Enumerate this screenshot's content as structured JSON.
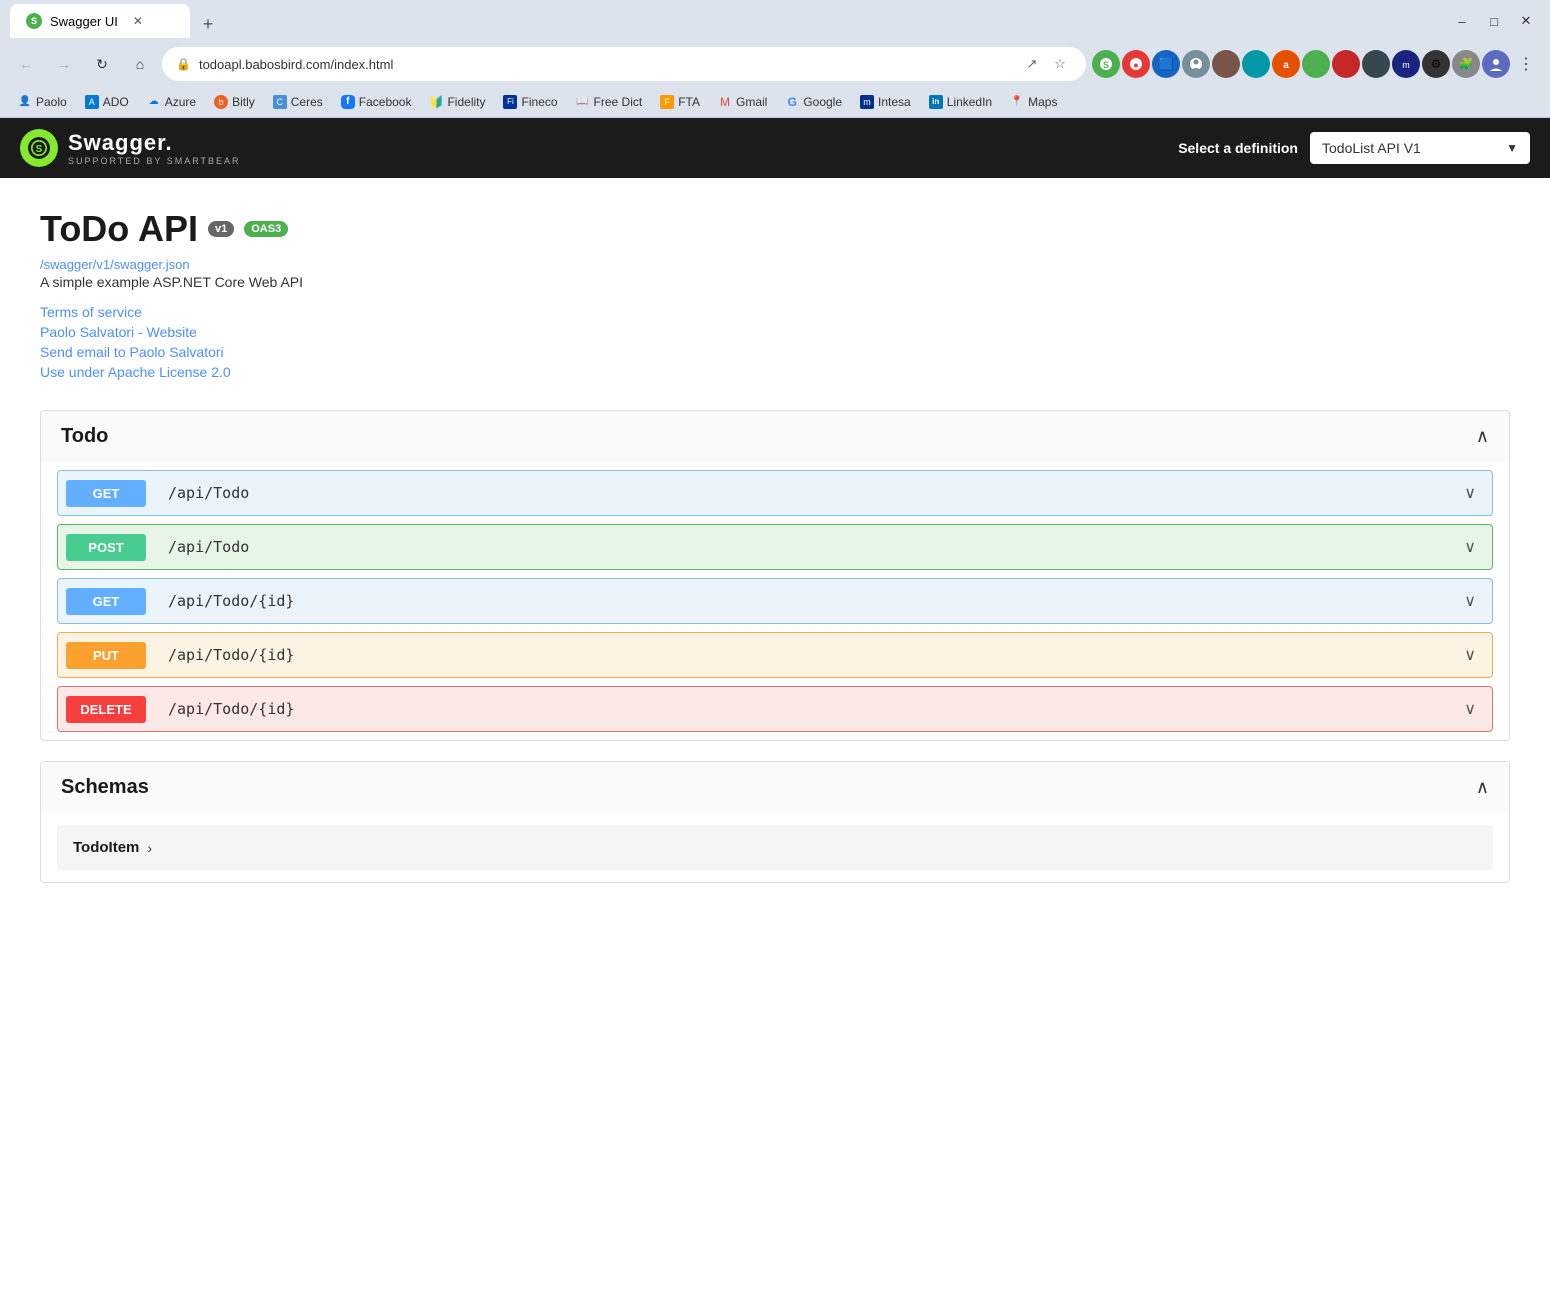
{
  "browser": {
    "tab": {
      "title": "Swagger UI",
      "favicon": "S"
    },
    "new_tab": "+",
    "window_controls": {
      "minimize": "–",
      "maximize": "□",
      "close": "✕"
    },
    "nav": {
      "back": "←",
      "forward": "→",
      "reload": "↻",
      "home": "⌂"
    },
    "url": "todoapl.babosbird.com/index.html",
    "url_actions": [
      "↗",
      "☆"
    ],
    "extensions": [
      "🟢",
      "🔴",
      "🟦",
      "👤",
      "🟤",
      "🌐",
      "🅰",
      "🟢",
      "🔴",
      "📦",
      "Ⓜ",
      "⚙",
      "🧩",
      "👤",
      "⋮"
    ]
  },
  "bookmarks": [
    {
      "label": "Paolo",
      "icon": "👤"
    },
    {
      "label": "ADO",
      "icon": "A"
    },
    {
      "label": "Azure",
      "icon": "☁"
    },
    {
      "label": "Bitly",
      "icon": "B"
    },
    {
      "label": "Ceres",
      "icon": "C"
    },
    {
      "label": "Facebook",
      "icon": "f"
    },
    {
      "label": "Fidelity",
      "icon": "F"
    },
    {
      "label": "Fineco",
      "icon": "Fi"
    },
    {
      "label": "Free Dict",
      "icon": "D"
    },
    {
      "label": "FTA",
      "icon": "F"
    },
    {
      "label": "Gmail",
      "icon": "M"
    },
    {
      "label": "Google",
      "icon": "G"
    },
    {
      "label": "Intesa",
      "icon": "I"
    },
    {
      "label": "LinkedIn",
      "icon": "in"
    },
    {
      "label": "Maps",
      "icon": "📍"
    }
  ],
  "swagger": {
    "logo_text": "Swagger.",
    "logo_sub": "SUPPORTED BY SMARTBEAR",
    "select_label": "Select a definition",
    "select_value": "TodoList API V1",
    "select_options": [
      "TodoList API V1"
    ]
  },
  "api": {
    "title": "ToDo API",
    "badge_v1": "v1",
    "badge_oas3": "OAS3",
    "url": "/swagger/v1/swagger.json",
    "description": "A simple example ASP.NET Core Web API",
    "links": [
      {
        "label": "Terms of service"
      },
      {
        "label": "Paolo Salvatori - Website"
      },
      {
        "label": "Send email to Paolo Salvatori"
      },
      {
        "label": "Use under Apache License 2.0"
      }
    ]
  },
  "todo_section": {
    "title": "Todo",
    "chevron": "∧",
    "endpoints": [
      {
        "method": "GET",
        "path": "/api/Todo",
        "type": "get"
      },
      {
        "method": "POST",
        "path": "/api/Todo",
        "type": "post"
      },
      {
        "method": "GET",
        "path": "/api/Todo/{id}",
        "type": "get"
      },
      {
        "method": "PUT",
        "path": "/api/Todo/{id}",
        "type": "put"
      },
      {
        "method": "DELETE",
        "path": "/api/Todo/{id}",
        "type": "delete"
      }
    ]
  },
  "schemas_section": {
    "title": "Schemas",
    "chevron": "∧",
    "items": [
      {
        "name": "TodoItem",
        "arrow": "›"
      }
    ]
  }
}
